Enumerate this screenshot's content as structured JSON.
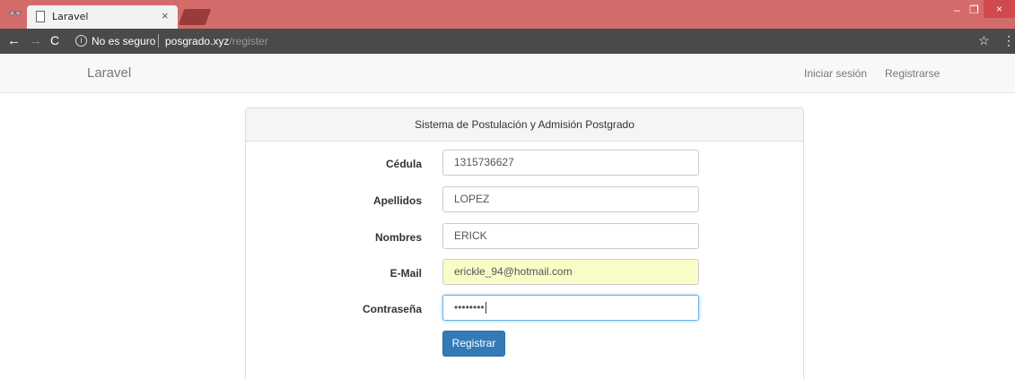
{
  "browser": {
    "tab_title": "Laravel",
    "tab_close": "×",
    "security_label": "No es seguro",
    "url_host": "posgrado.xyz",
    "url_path": "/register",
    "window_controls": {
      "minimize": "–",
      "maximize": "❐",
      "close": "×"
    },
    "icons": {
      "back": "←",
      "forward": "→",
      "reload": "C",
      "info": "i",
      "star": "☆",
      "menu": "⋮",
      "incognito": "👓"
    }
  },
  "navbar": {
    "brand": "Laravel",
    "login": "Iniciar sesión",
    "register": "Registrarse"
  },
  "panel": {
    "title": "Sistema de Postulación y Admisión Postgrado"
  },
  "form": {
    "cedula": {
      "label": "Cédula",
      "value": "1315736627"
    },
    "apellidos": {
      "label": "Apellidos",
      "value": "LOPEZ"
    },
    "nombres": {
      "label": "Nombres",
      "value": "ERICK"
    },
    "email": {
      "label": "E-Mail",
      "value": "erickle_94@hotmail.com"
    },
    "password": {
      "label": "Contraseña",
      "value": "••••••••"
    },
    "submit": "Registrar"
  },
  "colors": {
    "titlebar": "#d46b6b",
    "toolbar": "#4a4a4a",
    "primary": "#337ab7",
    "autofill": "#fafcc8",
    "focus": "#66afe9"
  }
}
